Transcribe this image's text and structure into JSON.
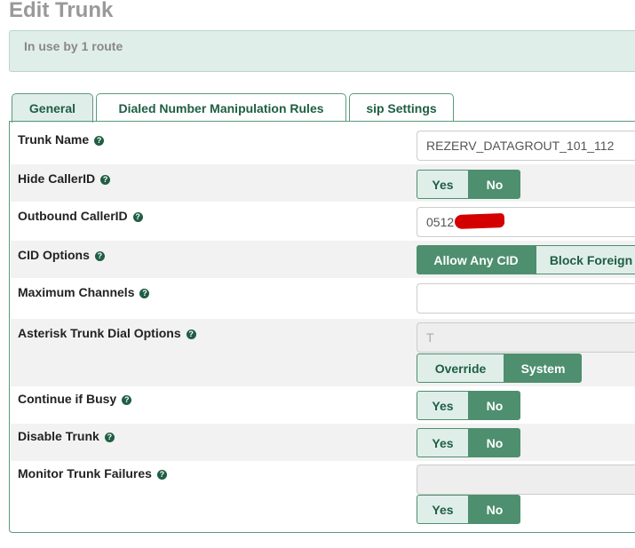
{
  "page_title": "Edit Trunk",
  "notice": "In use by 1 route",
  "tabs": {
    "general": "General",
    "dialed": "Dialed Number Manipulation Rules",
    "sip": "sip Settings"
  },
  "fields": {
    "trunk_name": {
      "label": "Trunk Name",
      "value": "REZERV_DATAGROUT_101_112"
    },
    "hide_callerid": {
      "label": "Hide CallerID",
      "yes": "Yes",
      "no": "No",
      "selected": "No"
    },
    "outbound_callerid": {
      "label": "Outbound CallerID",
      "value": "0512"
    },
    "cid_options": {
      "label": "CID Options",
      "allow_any": "Allow Any CID",
      "block_foreign": "Block Foreign",
      "selected": "Allow Any CID"
    },
    "max_channels": {
      "label": "Maximum Channels",
      "value": ""
    },
    "dial_options": {
      "label": "Asterisk Trunk Dial Options",
      "value": "T",
      "override": "Override",
      "system": "System",
      "selected": "System"
    },
    "continue_busy": {
      "label": "Continue if Busy",
      "yes": "Yes",
      "no": "No",
      "selected": "No"
    },
    "disable_trunk": {
      "label": "Disable Trunk",
      "yes": "Yes",
      "no": "No",
      "selected": "No"
    },
    "monitor_failures": {
      "label": "Monitor Trunk Failures",
      "value": "",
      "yes": "Yes",
      "no": "No",
      "selected": "No"
    }
  },
  "help_icon_glyph": "?",
  "colors": {
    "accent": "#4d8f6e",
    "accent_light": "#e0eeea",
    "tab_text": "#1f5e44",
    "redaction": "#d40000"
  }
}
